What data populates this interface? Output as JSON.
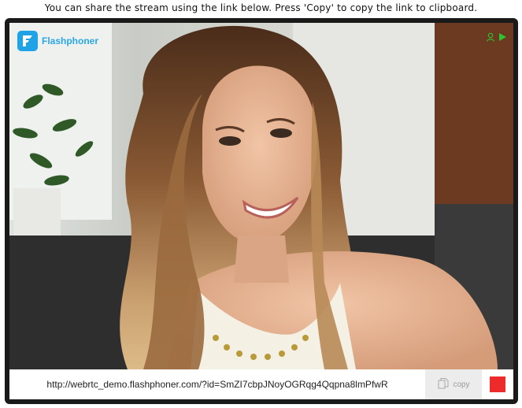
{
  "page": {
    "instruction": "You can share the stream using the link below. Press 'Copy' to copy the link to clipboard."
  },
  "player": {
    "brand_name": "Flashphoner",
    "icons": {
      "brand": "flashphoner-logo-icon",
      "viewer": "viewer-user-icon",
      "live": "play-status-icon",
      "copy": "copy-document-icon"
    },
    "colors": {
      "brand": "#1fa3e6",
      "live": "#2fc12f",
      "stop": "#ee2b2b",
      "frame": "#1a1a1a"
    }
  },
  "share": {
    "link": "http://webrtc_demo.flashphoner.com/?id=SmZI7cbpJNoyOGRqg4Qqpna8lmPfwR",
    "copy_label": "copy"
  }
}
